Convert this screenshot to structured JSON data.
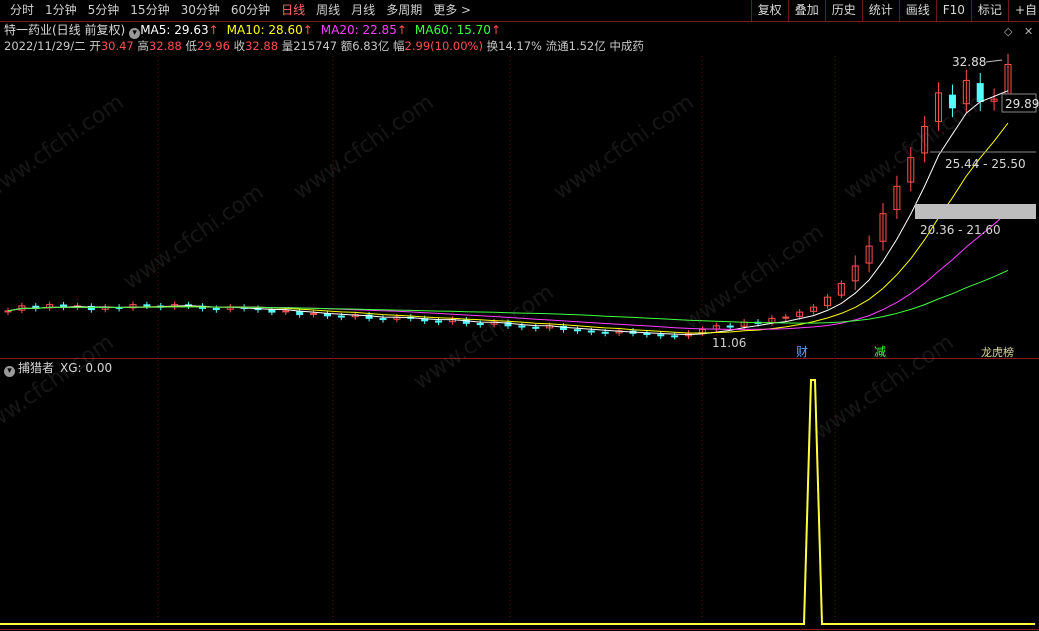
{
  "toolbar": {
    "period_tabs": [
      "分时",
      "1分钟",
      "5分钟",
      "15分钟",
      "30分钟",
      "60分钟",
      "日线",
      "周线",
      "月线",
      "多周期",
      "更多 >"
    ],
    "active_tab": "日线",
    "right_buttons": [
      "复权",
      "叠加",
      "历史",
      "统计",
      "画线",
      "F10",
      "标记",
      "+自"
    ]
  },
  "header": {
    "stock_title": "特一药业(日线 前复权)",
    "ma5_label": "MA5: 29.63",
    "ma10_label": "MA10: 28.60",
    "ma20_label": "MA20: 22.85",
    "ma60_label": "MA60: 15.70",
    "arrow": "↑"
  },
  "quote": {
    "date": "2022/11/29/二",
    "open_label": "开",
    "open": "30.47",
    "high_label": "高",
    "high": "32.88",
    "low_label": "低",
    "low": "29.96",
    "close_label": "收",
    "close": "32.88",
    "volume_label": "量",
    "volume": "215747",
    "amount_label": "额",
    "amount": "6.83亿",
    "change_label": "幅",
    "change": "2.99(10.00%)",
    "turnover_label": "换",
    "turnover": "14.17%",
    "float_label": "流通",
    "float_cap": "1.52亿",
    "sector": "中成药"
  },
  "annotations": {
    "high_price": "32.88",
    "right_price": "29.89",
    "range_upper": "25.44 - 25.50",
    "range_lower": "20.36 - 21.60",
    "low_price": "11.06",
    "marker_cai": "财",
    "marker_jian": "减",
    "marker_longhu": "龙虎榜"
  },
  "indicator": {
    "name": "捕猎者",
    "value_label": "XG: 0.00"
  },
  "watermark": "www.cfchi.com",
  "colors": {
    "background": "#000000",
    "up": "#ff5050",
    "down": "#54ffff",
    "ma5": "#ffffff",
    "ma10": "#ffff00",
    "ma20": "#ff40ff",
    "ma60": "#40ff40",
    "xg_line": "#ffff40",
    "divider": "#8b1a1a"
  },
  "chart_data": {
    "type": "candlestick",
    "x_label": "",
    "y_label": "",
    "note_last_bar": {
      "open": 30.47,
      "high": 32.88,
      "low": 29.96,
      "close": 32.88
    },
    "closes": [
      13.1,
      13.5,
      13.3,
      13.6,
      13.4,
      13.5,
      13.2,
      13.4,
      13.3,
      13.6,
      13.5,
      13.4,
      13.6,
      13.5,
      13.3,
      13.2,
      13.4,
      13.3,
      13.2,
      13.0,
      13.1,
      12.8,
      12.9,
      12.7,
      12.6,
      12.8,
      12.5,
      12.4,
      12.6,
      12.5,
      12.3,
      12.2,
      12.4,
      12.1,
      12.0,
      12.2,
      11.9,
      11.8,
      11.7,
      11.9,
      11.6,
      11.5,
      11.4,
      11.3,
      11.5,
      11.3,
      11.2,
      11.1,
      11.06,
      11.3,
      11.6,
      11.9,
      11.8,
      12.2,
      12.1,
      12.5,
      12.6,
      13.0,
      13.4,
      14.2,
      15.3,
      16.7,
      18.3,
      20.9,
      23.1,
      25.4,
      27.9,
      30.6,
      29.4,
      31.6,
      29.9,
      30.1,
      32.88
    ],
    "xg_signal_index": 55,
    "xg_values_note": "XG is 0 everywhere except a single spike of 1 near 财 marker"
  }
}
